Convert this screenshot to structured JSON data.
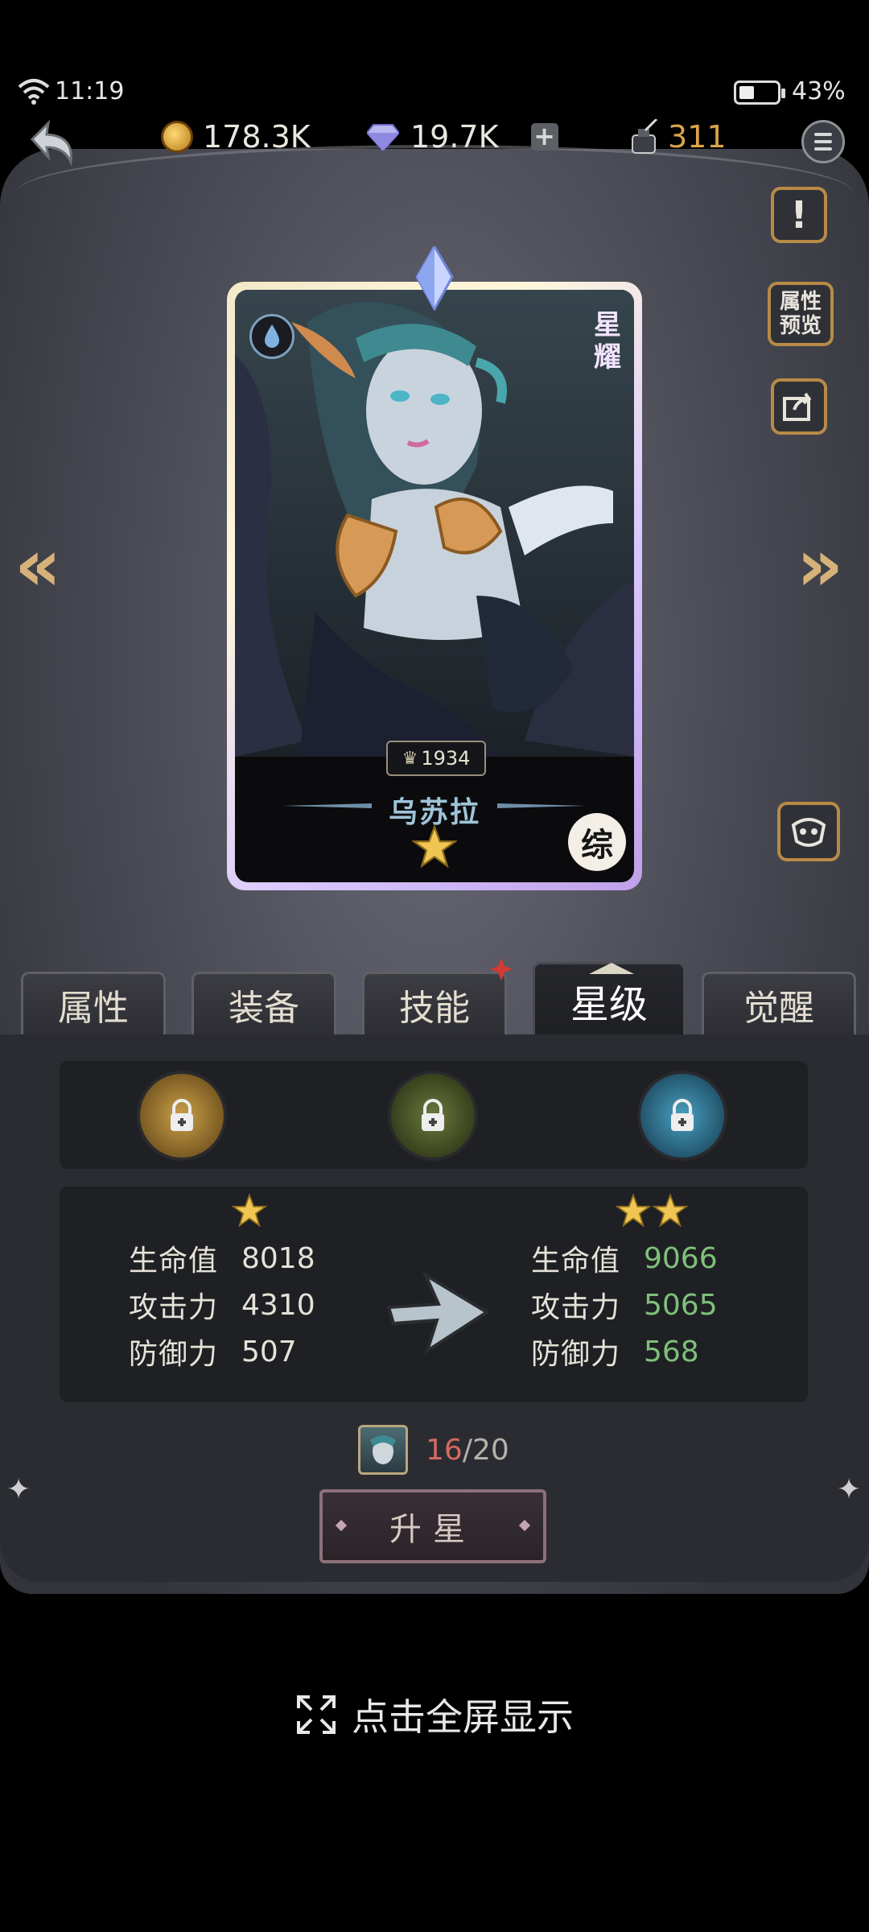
{
  "status": {
    "time": "11:19",
    "battery": "43%"
  },
  "currency": {
    "gold": "178.3K",
    "gems": "19.7K",
    "ink": "311"
  },
  "side_buttons": {
    "attr_preview": "属性\n预览"
  },
  "card": {
    "power": "1934",
    "name": "乌苏拉",
    "star_tag": "星耀",
    "class_badge": "综"
  },
  "tabs": [
    "属性",
    "装备",
    "技能",
    "星级",
    "觉醒"
  ],
  "stats": {
    "current": {
      "stars": 1,
      "hp_label": "生命值",
      "hp": "8018",
      "atk_label": "攻击力",
      "atk": "4310",
      "def_label": "防御力",
      "def": "507"
    },
    "next": {
      "stars": 2,
      "hp_label": "生命值",
      "hp": "9066",
      "atk_label": "攻击力",
      "atk": "5065",
      "def_label": "防御力",
      "def": "568"
    }
  },
  "shards": {
    "have": "16",
    "sep": "/",
    "need": "20"
  },
  "upgrade_button": "升星",
  "fullscreen_hint": "点击全屏显示",
  "colors": {
    "accent_gold": "#b78a47",
    "stat_up_green": "#7fc07a",
    "shard_red": "#d26a63"
  }
}
